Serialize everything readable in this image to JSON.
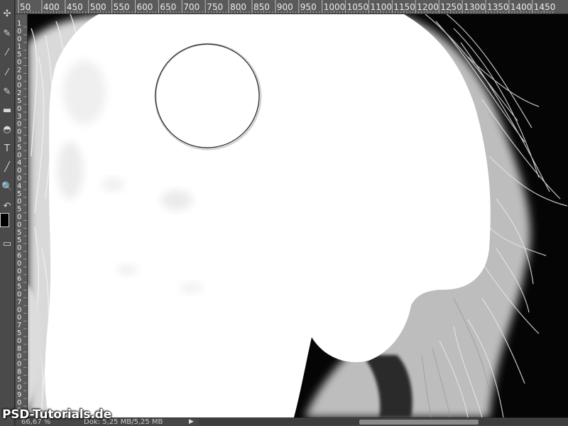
{
  "ruler": {
    "h_ticks": [
      "50",
      "400",
      "450",
      "500",
      "550",
      "600",
      "650",
      "700",
      "750",
      "800",
      "850",
      "900",
      "950",
      "1000",
      "1050",
      "1100",
      "1150",
      "1200",
      "1250",
      "1300",
      "1350",
      "1400",
      "1450"
    ],
    "v_ticks": [
      "1",
      "0",
      "0",
      "1",
      "5",
      "0",
      "2",
      "0",
      "0",
      "2",
      "5",
      "0",
      "3",
      "0",
      "0",
      "3",
      "5",
      "0",
      "4",
      "0",
      "0",
      "4",
      "5",
      "0",
      "5",
      "0",
      "0",
      "5",
      "5",
      "0",
      "6",
      "0",
      "0",
      "6",
      "5",
      "0",
      "7",
      "0",
      "0",
      "7",
      "5",
      "0",
      "8",
      "0",
      "0",
      "8",
      "5",
      "0",
      "9",
      "0",
      "0",
      "9"
    ]
  },
  "toolbar": {
    "tools": [
      {
        "name": "move-tool-icon",
        "glyph": "✣"
      },
      {
        "name": "brush-tool-icon",
        "glyph": "✎"
      },
      {
        "name": "eyedropper-tool-icon",
        "glyph": "⁄"
      },
      {
        "name": "selection-brush-tool-icon",
        "glyph": "⁄"
      },
      {
        "name": "mixer-brush-tool-icon",
        "glyph": "✎"
      },
      {
        "name": "gradient-tool-icon",
        "glyph": "▬"
      },
      {
        "name": "smudge-tool-icon",
        "glyph": "◓"
      },
      {
        "name": "text-tool-icon",
        "glyph": "T"
      },
      {
        "name": "line-tool-icon",
        "glyph": "╱"
      },
      {
        "name": "zoom-tool-icon",
        "glyph": "🔍"
      },
      {
        "name": "swap-colors-icon",
        "glyph": "↶"
      },
      {
        "name": "screen-mode-icon",
        "glyph": "▭"
      }
    ]
  },
  "status": {
    "zoom": "66,67 %",
    "doc": "Dok: 5,25 MB/5,25 MB",
    "arrow": "▶"
  },
  "watermark": "PSD-Tutorials.de",
  "colors": {
    "background_layer": "#050505",
    "mask_white": "#ffffff",
    "ui_panel": "#4a4a4a",
    "ruler": "#5a5a5a"
  }
}
